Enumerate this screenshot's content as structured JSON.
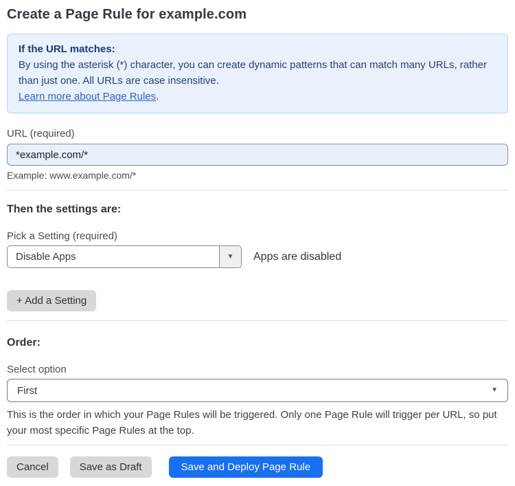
{
  "page": {
    "title": "Create a Page Rule for example.com"
  },
  "info_box": {
    "heading": "If the URL matches:",
    "body": "By using the asterisk (*) character, you can create dynamic patterns that can match many URLs, rather than just one. All URLs are case insensitive.",
    "link_label": "Learn more about Page Rules",
    "link_suffix": "."
  },
  "url_field": {
    "label": "URL (required)",
    "value": "*example.com/*",
    "helper": "Example: www.example.com/*"
  },
  "settings_section": {
    "heading": "Then the settings are:",
    "picker_label": "Pick a Setting (required)",
    "picker_value": "Disable Apps",
    "status_text": "Apps are disabled",
    "add_setting_label": "+ Add a Setting"
  },
  "order_section": {
    "heading": "Order:",
    "select_label": "Select option",
    "select_value": "First",
    "caret_glyph": "▼",
    "helper": "This is the order in which your Page Rules will be triggered. Only one Page Rule will trigger per URL, so put your most specific Page Rules at the top."
  },
  "actions": {
    "cancel_label": "Cancel",
    "save_draft_label": "Save as Draft",
    "save_deploy_label": "Save and Deploy Page Rule"
  },
  "colors": {
    "primary_blue": "#1670f2",
    "info_background": "#e9f1fc",
    "info_border": "#bcd4f0",
    "info_text": "#24407c",
    "link_blue": "#2f62d3",
    "input_background": "#e8f0fc",
    "gray_button": "#d8d8d8"
  }
}
